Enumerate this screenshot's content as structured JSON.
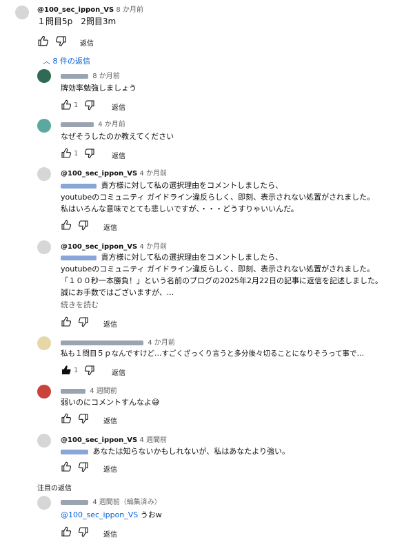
{
  "parent": {
    "author": "@100_sec_ippon_VS",
    "time": "8 か月前",
    "text": "１問目5p　2問目3m",
    "reply_label": "返信"
  },
  "replies_toggle": "8 件の返信",
  "replies": [
    {
      "time": "8 か月前",
      "lines": [
        "牌効率勉強しましょう"
      ],
      "likes": "1",
      "reply_label": "返信"
    },
    {
      "time": "4 か月前",
      "lines": [
        "なぜそうしたのか教えてください"
      ],
      "likes": "1",
      "reply_label": "返信"
    },
    {
      "author": "@100_sec_ippon_VS",
      "time": "4 か月前",
      "lines": [
        "貴方様に対して私の選択理由をコメントしましたら、",
        "youtubeのコミュニティ ガイドライン違反らしく、即刻、表示されない処置がされました。",
        "私はいろんな意味でとても悲しいですが、・・・どうすりゃいいんだ。"
      ],
      "reply_label": "返信"
    },
    {
      "author": "@100_sec_ippon_VS",
      "time": "4 か月前",
      "lines": [
        "貴方様に対して私の選択理由をコメントしましたら、",
        "youtubeのコミュニティ ガイドライン違反らしく、即刻、表示されない処置がされました。",
        "「１００秒一本勝負！」という名前のブログの2025年2月22日の記事に返信を記述しました。",
        "誠にお手数ではございますが、..."
      ],
      "read_more": "続きを読む",
      "reply_label": "返信"
    },
    {
      "time": "4 か月前",
      "lines": [
        "私も１問目５ｐなんですけど…すごくざっくり言うと多分後々切ることになりそうって事で…"
      ],
      "likes": "1",
      "reply_label": "返信"
    },
    {
      "time": "4 週間前",
      "lines": [
        "弱いのにコメントすんなよ😅"
      ],
      "reply_label": "返信"
    },
    {
      "author": "@100_sec_ippon_VS",
      "time": "4 週間前",
      "lines": [
        "あなたは知らないかもしれないが、私はあなたより強い。"
      ],
      "reply_label": "返信"
    }
  ],
  "pinned_label": "注目の返信",
  "pinned": {
    "time": "4 週間前（編集済み）",
    "mention": "@100_sec_ippon_VS",
    "text": " うおw",
    "reply_label": "返信"
  }
}
